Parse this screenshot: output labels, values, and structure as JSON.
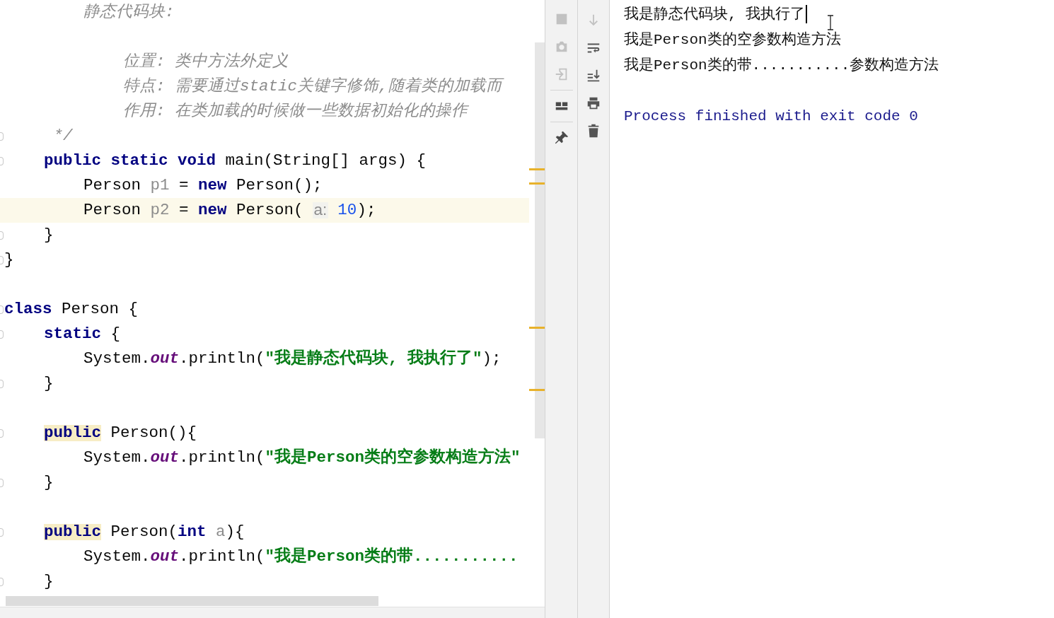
{
  "editor": {
    "lines": [
      {
        "kind": "group",
        "children": [
          {
            "kind": "group",
            "children": [
              {
                "kind": "code",
                "fold": false,
                "highlighted": false,
                "tokens": [
                  {
                    "kind": "comment",
                    "text": "静态代码块:"
                  }
                ]
              },
              {
                "kind": "blank",
                "fold": false,
                "highlighted": false
              },
              {
                "kind": "group",
                "children": [
                  {
                    "kind": "code",
                    "fold": false,
                    "highlighted": false,
                    "tokens": [
                      {
                        "kind": "comment",
                        "text": "位置: 类中方法外定义"
                      }
                    ]
                  },
                  {
                    "kind": "code",
                    "fold": false,
                    "highlighted": false,
                    "tokens": [
                      {
                        "kind": "comment",
                        "text": "特点: 需要通过static关键字修饰,随着类的加载而"
                      }
                    ]
                  },
                  {
                    "kind": "code",
                    "fold": false,
                    "highlighted": false,
                    "tokens": [
                      {
                        "kind": "comment",
                        "text": "作用: 在类加载的时候做一些数据初始化的操作"
                      }
                    ]
                  }
                ]
              }
            ]
          },
          {
            "kind": "code",
            "fold": true,
            "highlighted": false,
            "tokens": [
              {
                "kind": "comment",
                "text": " */"
              }
            ]
          },
          {
            "kind": "code",
            "fold": true,
            "highlighted": false,
            "tokens": [
              {
                "kind": "keyword",
                "text": "public static void"
              },
              {
                "kind": "plain",
                "text": " main(String[] args) {"
              }
            ],
            "children": [
              {
                "kind": "code",
                "fold": false,
                "highlighted": false,
                "tokens": [
                  {
                    "kind": "plain",
                    "text": "Person "
                  },
                  {
                    "kind": "unused",
                    "text": "p1"
                  },
                  {
                    "kind": "plain",
                    "text": " = "
                  },
                  {
                    "kind": "keyword",
                    "text": "new"
                  },
                  {
                    "kind": "plain",
                    "text": " Person();"
                  }
                ]
              },
              {
                "kind": "code",
                "fold": false,
                "highlighted": true,
                "tokens": [
                  {
                    "kind": "plain",
                    "text": "Person "
                  },
                  {
                    "kind": "unused",
                    "text": "p2"
                  },
                  {
                    "kind": "plain",
                    "text": " = "
                  },
                  {
                    "kind": "keyword",
                    "text": "new"
                  },
                  {
                    "kind": "plain",
                    "text": " Person("
                  },
                  {
                    "kind": "hint",
                    "text": "a:"
                  },
                  {
                    "kind": "number",
                    "text": "10"
                  },
                  {
                    "kind": "plain",
                    "text": ");"
                  }
                ]
              }
            ]
          },
          {
            "kind": "code",
            "fold": true,
            "highlighted": false,
            "tokens": [
              {
                "kind": "plain",
                "text": "}"
              }
            ]
          }
        ]
      },
      {
        "kind": "code",
        "fold": true,
        "highlighted": false,
        "tokens": [
          {
            "kind": "plain",
            "text": "}"
          }
        ]
      },
      {
        "kind": "blank",
        "fold": false,
        "highlighted": false
      },
      {
        "kind": "code",
        "fold": true,
        "highlighted": false,
        "tokens": [
          {
            "kind": "keyword",
            "text": "class"
          },
          {
            "kind": "plain",
            "text": " Person {"
          }
        ],
        "children": [
          {
            "kind": "code",
            "fold": true,
            "highlighted": false,
            "tokens": [
              {
                "kind": "keyword",
                "text": "static"
              },
              {
                "kind": "plain",
                "text": " {"
              }
            ],
            "children": [
              {
                "kind": "code",
                "fold": false,
                "highlighted": false,
                "tokens": [
                  {
                    "kind": "plain",
                    "text": "System."
                  },
                  {
                    "kind": "field",
                    "text": "out"
                  },
                  {
                    "kind": "plain",
                    "text": ".println("
                  },
                  {
                    "kind": "string",
                    "text": "\"我是静态代码块, 我执行了\""
                  },
                  {
                    "kind": "plain",
                    "text": ");"
                  }
                ]
              }
            ]
          },
          {
            "kind": "code",
            "fold": true,
            "highlighted": false,
            "tokens": [
              {
                "kind": "plain",
                "text": "}"
              }
            ]
          },
          {
            "kind": "blank",
            "fold": false,
            "highlighted": false
          },
          {
            "kind": "code",
            "fold": true,
            "highlighted": false,
            "tokens": [
              {
                "kind": "marked",
                "text": "public"
              },
              {
                "kind": "plain",
                "text": " Person(){"
              }
            ],
            "children": [
              {
                "kind": "code",
                "fold": false,
                "highlighted": false,
                "tokens": [
                  {
                    "kind": "plain",
                    "text": "System."
                  },
                  {
                    "kind": "field",
                    "text": "out"
                  },
                  {
                    "kind": "plain",
                    "text": ".println("
                  },
                  {
                    "kind": "string",
                    "text": "\"我是Person类的空参数构造方法\""
                  }
                ]
              }
            ]
          },
          {
            "kind": "code",
            "fold": true,
            "highlighted": false,
            "tokens": [
              {
                "kind": "plain",
                "text": "}"
              }
            ]
          },
          {
            "kind": "blank",
            "fold": false,
            "highlighted": false
          },
          {
            "kind": "code",
            "fold": true,
            "highlighted": false,
            "tokens": [
              {
                "kind": "marked",
                "text": "public"
              },
              {
                "kind": "plain",
                "text": " Person("
              },
              {
                "kind": "keyword",
                "text": "int"
              },
              {
                "kind": "unused",
                "text": "a"
              },
              {
                "kind": "plain",
                "text": "){"
              }
            ],
            "children": [
              {
                "kind": "code",
                "fold": false,
                "highlighted": false,
                "tokens": [
                  {
                    "kind": "plain",
                    "text": "System."
                  },
                  {
                    "kind": "field",
                    "text": "out"
                  },
                  {
                    "kind": "plain",
                    "text": ".println("
                  },
                  {
                    "kind": "string",
                    "text": "\"我是Person类的带..........."
                  }
                ]
              }
            ]
          },
          {
            "kind": "code",
            "fold": true,
            "highlighted": false,
            "tokens": [
              {
                "kind": "plain",
                "text": "}"
              }
            ]
          }
        ]
      }
    ]
  },
  "console": {
    "lines": [
      {
        "kind": "output",
        "caret": true,
        "text": "我是静态代码块, 我执行了"
      },
      {
        "kind": "output",
        "caret": false,
        "text": "我是Person类的空参数构造方法"
      },
      {
        "kind": "output",
        "caret": false,
        "text": "我是Person类的带...........参数构造方法"
      },
      {
        "kind": "blank",
        "caret": false
      },
      {
        "kind": "system",
        "caret": false,
        "text": "Process finished with exit code 0"
      }
    ]
  }
}
